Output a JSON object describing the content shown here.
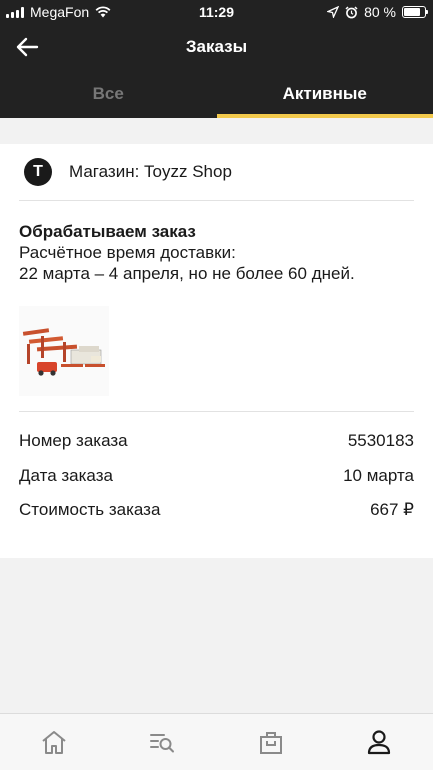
{
  "status_bar": {
    "carrier": "MegaFon",
    "time": "11:29",
    "battery_percent_label": "80 %",
    "battery_level": 0.8
  },
  "nav": {
    "title": "Заказы",
    "back_icon": "arrow-left-icon"
  },
  "tabs": [
    {
      "label": "Все",
      "active": false
    },
    {
      "label": "Активные",
      "active": true
    }
  ],
  "shop": {
    "logo_letter": "T",
    "name": "Магазин: Toyzz Shop"
  },
  "order_status": {
    "title": "Обрабатываем заказ",
    "line1": "Расчётное время доставки:",
    "line2": "22 марта – 4 апреля, но не более 60 дней."
  },
  "details": [
    {
      "label": "Номер заказа",
      "value": "5530183"
    },
    {
      "label": "Дата заказа",
      "value": "10 марта"
    },
    {
      "label": "Стоимость заказа",
      "value": "667 ₽"
    }
  ],
  "tabbar_icons": [
    "home-icon",
    "catalog-search-icon",
    "bag-icon",
    "profile-icon"
  ],
  "colors": {
    "header_bg": "#222222",
    "accent": "#f2c94c",
    "background": "#f2f2f2"
  }
}
